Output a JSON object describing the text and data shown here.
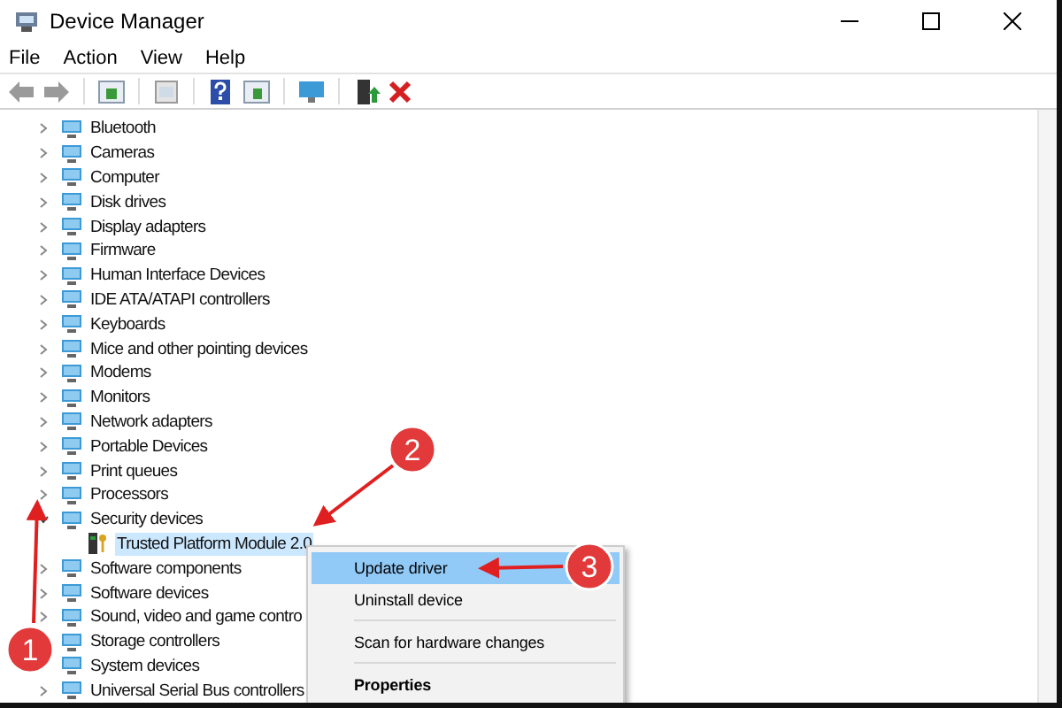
{
  "window": {
    "title": "Device Manager"
  },
  "menu": [
    "File",
    "Action",
    "View",
    "Help"
  ],
  "tree": [
    {
      "label": "Bluetooth",
      "expanded": false
    },
    {
      "label": "Cameras",
      "expanded": false
    },
    {
      "label": "Computer",
      "expanded": false
    },
    {
      "label": "Disk drives",
      "expanded": false
    },
    {
      "label": "Display adapters",
      "expanded": false
    },
    {
      "label": "Firmware",
      "expanded": false
    },
    {
      "label": "Human Interface Devices",
      "expanded": false
    },
    {
      "label": "IDE ATA/ATAPI controllers",
      "expanded": false
    },
    {
      "label": "Keyboards",
      "expanded": false
    },
    {
      "label": "Mice and other pointing devices",
      "expanded": false
    },
    {
      "label": "Modems",
      "expanded": false
    },
    {
      "label": "Monitors",
      "expanded": false
    },
    {
      "label": "Network adapters",
      "expanded": false
    },
    {
      "label": "Portable Devices",
      "expanded": false
    },
    {
      "label": "Print queues",
      "expanded": false
    },
    {
      "label": "Processors",
      "expanded": false
    },
    {
      "label": "Security devices",
      "expanded": true,
      "children": [
        {
          "label": "Trusted Platform Module 2.0",
          "selected": true
        }
      ]
    },
    {
      "label": "Software components",
      "expanded": false
    },
    {
      "label": "Software devices",
      "expanded": false
    },
    {
      "label": "Sound, video and game contro",
      "expanded": false
    },
    {
      "label": "Storage controllers"
    },
    {
      "label": "System devices"
    },
    {
      "label": "Universal Serial Bus controllers",
      "expanded": false
    }
  ],
  "context_menu": [
    {
      "label": "Update driver",
      "selected": true,
      "bold": false
    },
    {
      "label": "Uninstall device",
      "selected": false,
      "bold": false,
      "separator_after": true
    },
    {
      "label": "Scan for hardware changes",
      "selected": false,
      "bold": false,
      "separator_after": true
    },
    {
      "label": "Properties",
      "selected": false,
      "bold": true
    }
  ],
  "callouts": [
    {
      "label": "1"
    },
    {
      "label": "2"
    },
    {
      "label": "3"
    }
  ]
}
